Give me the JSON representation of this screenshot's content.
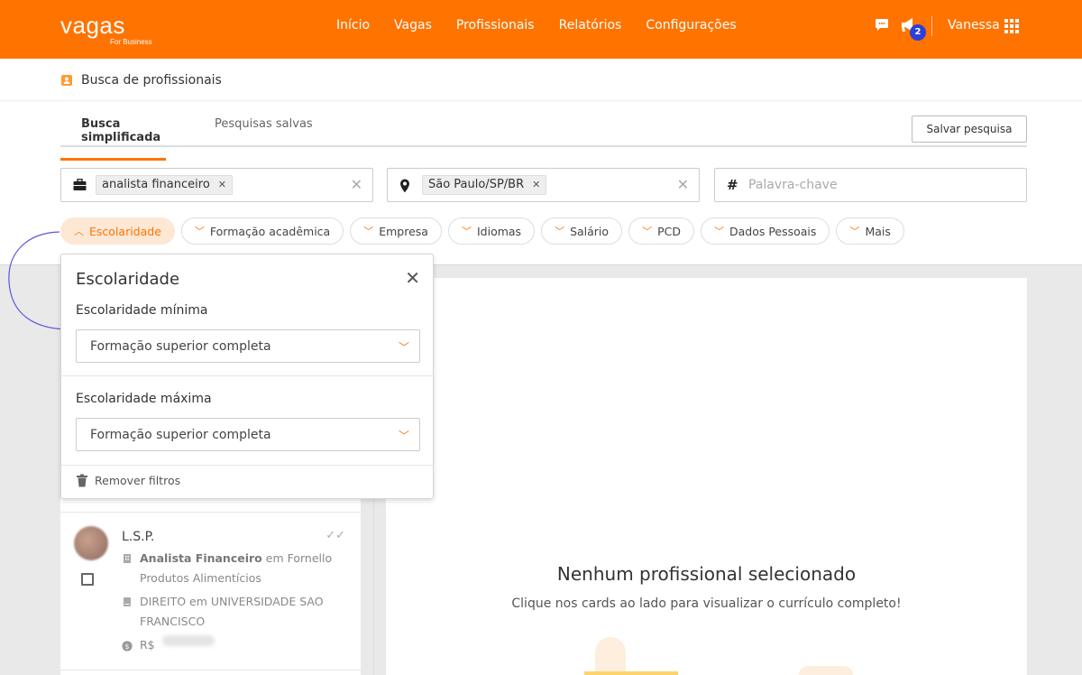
{
  "header": {
    "brand": "vagas",
    "brand_sub": "For Business",
    "nav": [
      "Início",
      "Vagas",
      "Profissionais",
      "Relatórios",
      "Configurações"
    ],
    "notification_count": "2",
    "user_name": "Vanessa",
    "bg_color": "#ff7300"
  },
  "page": {
    "title": "Busca de profissionais",
    "tabs": {
      "active": "Busca simplificada",
      "inactive": "Pesquisas salvas"
    },
    "save_label": "Salvar pesquisa"
  },
  "search": {
    "role_chip": "analista financeiro",
    "location_chip": "São Paulo/SP/BR",
    "keyword_placeholder": "Palavra-chave"
  },
  "filters": [
    "Escolaridade",
    "Formação acadêmica",
    "Empresa",
    "Idiomas",
    "Salário",
    "PCD",
    "Dados Pessoais",
    "Mais"
  ],
  "popover": {
    "title": "Escolaridade",
    "min_label": "Escolaridade mínima",
    "min_value": "Formação superior completa",
    "max_label": "Escolaridade máxima",
    "max_value": "Formação superior completa",
    "remove_label": "Remover filtros"
  },
  "card": {
    "name": "L.S.P.",
    "job_title": "Analista Financeiro",
    "job_at": "em Fornello",
    "job_company_cont": "Produtos Alimentícios",
    "education": "DIREITO em UNIVERSIDADE SAO",
    "education_cont": "FRANCISCO",
    "salary_prefix": "R$"
  },
  "empty_state": {
    "title": "Nenhum profissional selecionado",
    "subtitle": "Clique nos cards ao lado para visualizar o currículo completo!"
  }
}
